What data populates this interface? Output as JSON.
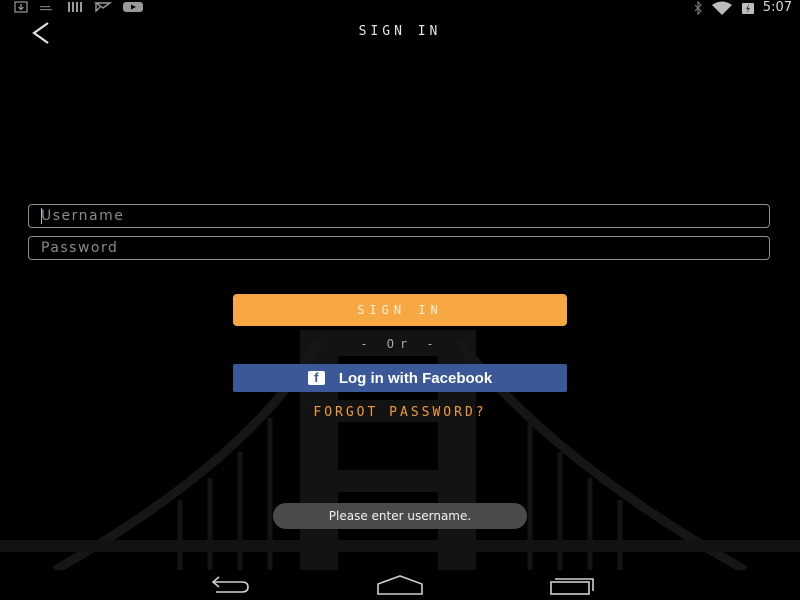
{
  "status_bar": {
    "left_icons": [
      "download-icon",
      "signal-bars-icon",
      "barcode-icon",
      "mail-icon",
      "youtube-icon"
    ],
    "right_icons": [
      "bluetooth-icon",
      "wifi-icon",
      "battery-charging-icon"
    ],
    "time": "5:07"
  },
  "header": {
    "title": "Sign In",
    "back_icon": "chevron-left-icon"
  },
  "form": {
    "username_placeholder": "Username",
    "password_placeholder": "Password",
    "username_value": "",
    "password_value": ""
  },
  "actions": {
    "sign_in_label": "Sign In",
    "or_label": "- Or -",
    "facebook_label": "Log in with Facebook",
    "facebook_icon": "facebook-icon",
    "forgot_label": "FORGOT PASSWORD?"
  },
  "toast": {
    "message": "Please enter username."
  },
  "nav_bar": {
    "icons": [
      "back-nav-icon",
      "home-nav-icon",
      "recents-nav-icon"
    ]
  },
  "colors": {
    "background": "#000000",
    "sign_in_button": "#f7a843",
    "facebook_button": "#3b5998",
    "forgot_link": "#f09a3e",
    "toast_bg": "#4a4a4a"
  }
}
